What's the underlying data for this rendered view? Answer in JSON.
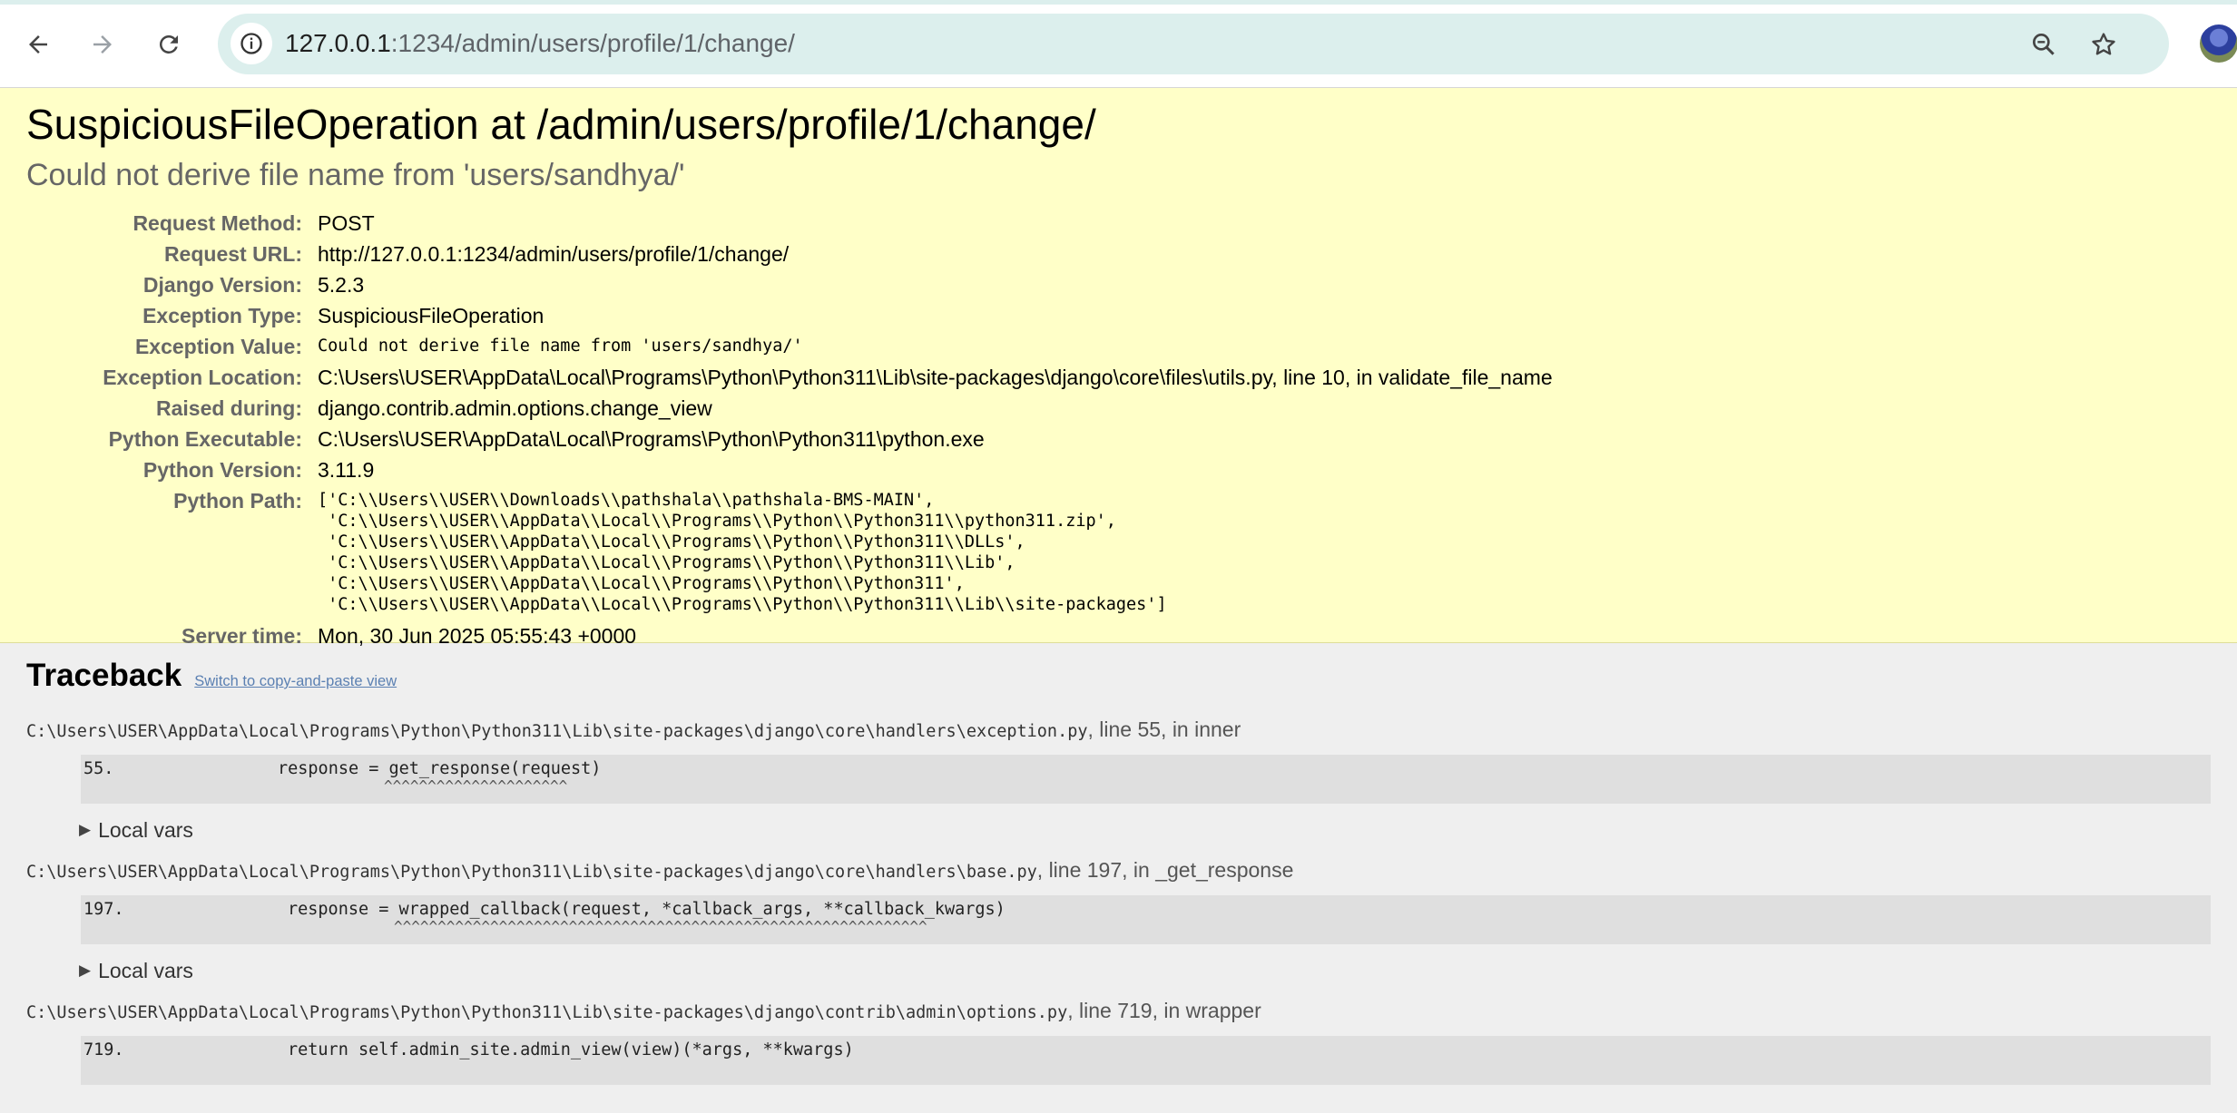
{
  "browser": {
    "url_host": "127.0.0.1",
    "url_rest": ":1234/admin/users/profile/1/change/"
  },
  "summary": {
    "title": "SuspiciousFileOperation at /admin/users/profile/1/change/",
    "subtitle": "Could not derive file name from 'users/sandhya/'",
    "rows": [
      {
        "label": "Request Method:",
        "value": "POST"
      },
      {
        "label": "Request URL:",
        "value": "http://127.0.0.1:1234/admin/users/profile/1/change/"
      },
      {
        "label": "Django Version:",
        "value": "5.2.3"
      },
      {
        "label": "Exception Type:",
        "value": "SuspiciousFileOperation"
      },
      {
        "label": "Exception Value:",
        "value": "Could not derive file name from 'users/sandhya/'"
      },
      {
        "label": "Exception Location:",
        "value": "C:\\Users\\USER\\AppData\\Local\\Programs\\Python\\Python311\\Lib\\site-packages\\django\\core\\files\\utils.py, line 10, in validate_file_name"
      },
      {
        "label": "Raised during:",
        "value": "django.contrib.admin.options.change_view"
      },
      {
        "label": "Python Executable:",
        "value": "C:\\Users\\USER\\AppData\\Local\\Programs\\Python\\Python311\\python.exe"
      },
      {
        "label": "Python Version:",
        "value": "3.11.9"
      },
      {
        "label": "Python Path:",
        "value": ""
      },
      {
        "label": "Server time:",
        "value": "Mon, 30 Jun 2025 05:55:43 +0000"
      }
    ],
    "python_path": [
      "['C:\\\\Users\\\\USER\\\\Downloads\\\\pathshala\\\\pathshala-BMS-MAIN',",
      " 'C:\\\\Users\\\\USER\\\\AppData\\\\Local\\\\Programs\\\\Python\\\\Python311\\\\python311.zip',",
      " 'C:\\\\Users\\\\USER\\\\AppData\\\\Local\\\\Programs\\\\Python\\\\Python311\\\\DLLs',",
      " 'C:\\\\Users\\\\USER\\\\AppData\\\\Local\\\\Programs\\\\Python\\\\Python311\\\\Lib',",
      " 'C:\\\\Users\\\\USER\\\\AppData\\\\Local\\\\Programs\\\\Python\\\\Python311',",
      " 'C:\\\\Users\\\\USER\\\\AppData\\\\Local\\\\Programs\\\\Python\\\\Python311\\\\Lib\\\\site-packages']"
    ]
  },
  "traceback": {
    "heading": "Traceback",
    "switch_link": "Switch to copy-and-paste view",
    "local_vars_label": "Local vars",
    "frames": [
      {
        "file": "C:\\Users\\USER\\AppData\\Local\\Programs\\Python\\Python311\\Lib\\site-packages\\django\\core\\handlers\\exception.py",
        "where": ", line 55, in inner",
        "line_no": "55.",
        "code": "response = get_response(request)",
        "caret": "^^^^^^^^^^^^^^^^^^^^^"
      },
      {
        "file": "C:\\Users\\USER\\AppData\\Local\\Programs\\Python\\Python311\\Lib\\site-packages\\django\\core\\handlers\\base.py",
        "where": ", line 197, in _get_response",
        "line_no": "197.",
        "code": "response = wrapped_callback(request, *callback_args, **callback_kwargs)",
        "caret": "^^^^^^^^^^^^^^^^^^^^^^^^^^^^^^^^^^^^^^^^^^^^^^^^^^^^^^^^^^^^^"
      },
      {
        "file": "C:\\Users\\USER\\AppData\\Local\\Programs\\Python\\Python311\\Lib\\site-packages\\django\\contrib\\admin\\options.py",
        "where": ", line 719, in wrapper",
        "line_no": "719.",
        "code": "return self.admin_site.admin_view(view)(*args, **kwargs)",
        "caret": ""
      }
    ]
  }
}
